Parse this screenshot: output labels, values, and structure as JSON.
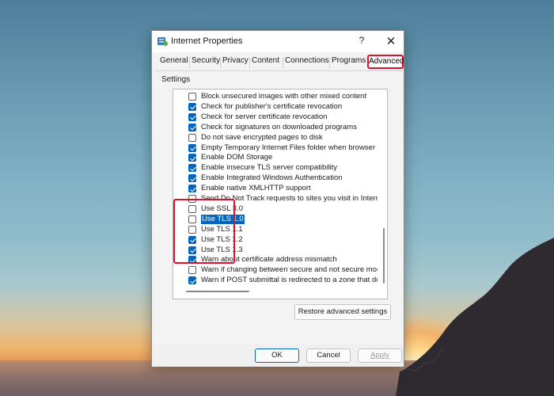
{
  "window": {
    "title": "Internet Properties",
    "help": "?",
    "close": "✕"
  },
  "tabs": [
    "General",
    "Security",
    "Privacy",
    "Content",
    "Connections",
    "Programs",
    "Advanced"
  ],
  "active_tab": "Advanced",
  "settings_label": "Settings",
  "settings": [
    {
      "label": "Block unsecured images with other mixed content",
      "checked": false
    },
    {
      "label": "Check for publisher's certificate revocation",
      "checked": true
    },
    {
      "label": "Check for server certificate revocation",
      "checked": true
    },
    {
      "label": "Check for signatures on downloaded programs",
      "checked": true
    },
    {
      "label": "Do not save encrypted pages to disk",
      "checked": false
    },
    {
      "label": "Empty Temporary Internet Files folder when browser is clo",
      "checked": true
    },
    {
      "label": "Enable DOM Storage",
      "checked": true
    },
    {
      "label": "Enable insecure TLS server compatibility",
      "checked": true
    },
    {
      "label": "Enable Integrated Windows Authentication",
      "checked": true
    },
    {
      "label": "Enable native XMLHTTP support",
      "checked": true
    },
    {
      "label": "Send Do Not Track requests to sites you visit in Internet E",
      "checked": false
    },
    {
      "label": "Use SSL 3.0",
      "checked": false
    },
    {
      "label": "Use TLS 1.0",
      "checked": false,
      "selected": true
    },
    {
      "label": "Use TLS 1.1",
      "checked": false
    },
    {
      "label": "Use TLS 1.2",
      "checked": true
    },
    {
      "label": "Use TLS 1.3",
      "checked": true
    },
    {
      "label": "Warn about certificate address mismatch",
      "checked": true
    },
    {
      "label": "Warn if changing between secure and not secure mode",
      "checked": false
    },
    {
      "label": "Warn if POST submittal is redirected to a zone that does n",
      "checked": true
    }
  ],
  "buttons": {
    "restore": "Restore advanced settings",
    "ok": "OK",
    "cancel": "Cancel",
    "apply": "Apply"
  },
  "colors": {
    "accent": "#0067c0",
    "highlight": "#e0102c"
  }
}
